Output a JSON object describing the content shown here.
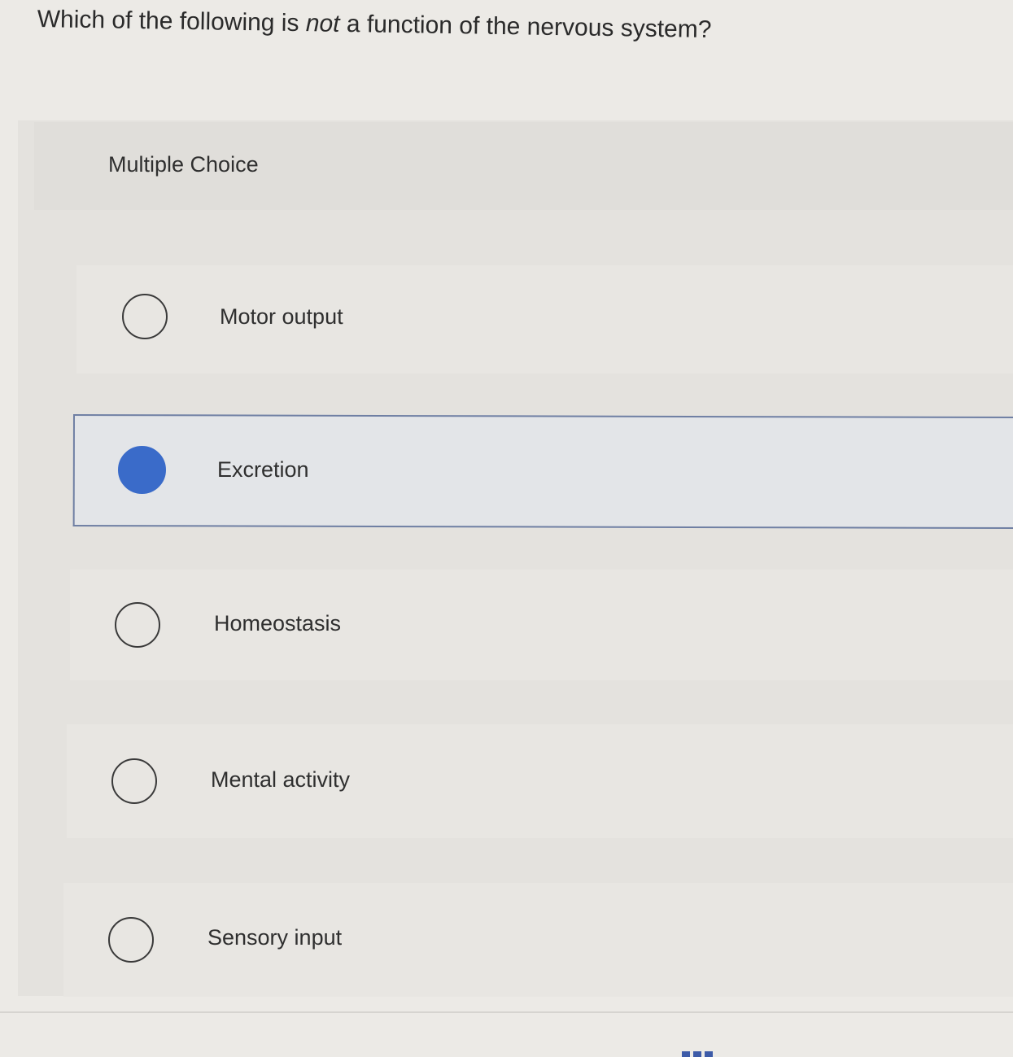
{
  "question": {
    "before": "Which of the following is ",
    "emphasis": "not",
    "after": " a function of the nervous system?"
  },
  "section_label": "Multiple Choice",
  "options": [
    {
      "label": "Motor output",
      "selected": false
    },
    {
      "label": "Excretion",
      "selected": true
    },
    {
      "label": "Homeostasis",
      "selected": false
    },
    {
      "label": "Mental activity",
      "selected": false
    },
    {
      "label": "Sensory input",
      "selected": false
    }
  ],
  "colors": {
    "selected_radio": "#3a6bc9",
    "selected_border": "#6f7fa3"
  }
}
